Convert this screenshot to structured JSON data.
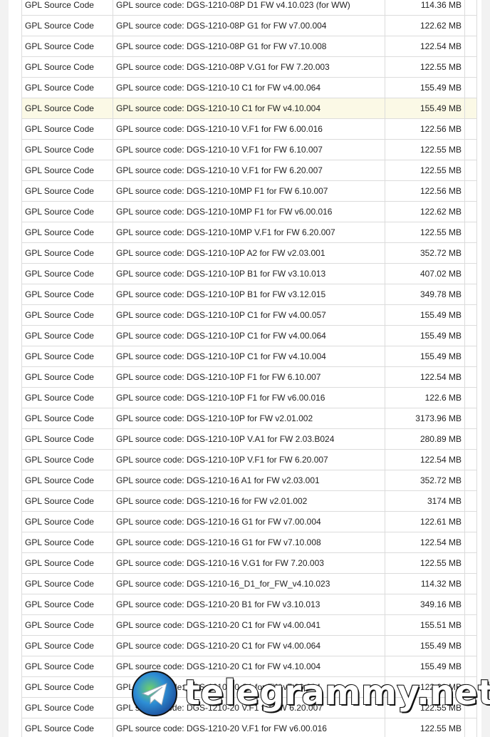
{
  "rows": [
    {
      "type": "GPL Source Code",
      "desc": "GPL source code: DGS-1210-08P D1 FW v4.10.023 (for WW)",
      "size": "114.36 MB"
    },
    {
      "type": "GPL Source Code",
      "desc": "GPL source code: DGS-1210-08P G1 for FW v7.00.004",
      "size": "122.62 MB"
    },
    {
      "type": "GPL Source Code",
      "desc": "GPL source code: DGS-1210-08P G1 for FW v7.10.008",
      "size": "122.54 MB"
    },
    {
      "type": "GPL Source Code",
      "desc": "GPL source code: DGS-1210-08P V.G1 for FW 7.20.003",
      "size": "122.55 MB"
    },
    {
      "type": "GPL Source Code",
      "desc": "GPL source code: DGS-1210-10 C1 for FW v4.00.064",
      "size": "155.49 MB"
    },
    {
      "type": "GPL Source Code",
      "desc": "GPL source code: DGS-1210-10 C1 for FW v4.10.004",
      "size": "155.49 MB",
      "highlight": true
    },
    {
      "type": "GPL Source Code",
      "desc": "GPL source code: DGS-1210-10 V.F1 for FW 6.00.016",
      "size": "122.56 MB"
    },
    {
      "type": "GPL Source Code",
      "desc": "GPL source code: DGS-1210-10 V.F1 for FW 6.10.007",
      "size": "122.55 MB"
    },
    {
      "type": "GPL Source Code",
      "desc": "GPL source code: DGS-1210-10 V.F1 for FW 6.20.007",
      "size": "122.55 MB"
    },
    {
      "type": "GPL Source Code",
      "desc": "GPL source code: DGS-1210-10MP F1 for FW 6.10.007",
      "size": "122.56 MB"
    },
    {
      "type": "GPL Source Code",
      "desc": "GPL source code: DGS-1210-10MP F1 for FW v6.00.016",
      "size": "122.62 MB"
    },
    {
      "type": "GPL Source Code",
      "desc": "GPL source code: DGS-1210-10MP V.F1 for FW 6.20.007",
      "size": "122.55 MB"
    },
    {
      "type": "GPL Source Code",
      "desc": "GPL source code: DGS-1210-10P A2 for FW v2.03.001",
      "size": "352.72 MB"
    },
    {
      "type": "GPL Source Code",
      "desc": "GPL source code: DGS-1210-10P B1 for FW v3.10.013",
      "size": "407.02 MB"
    },
    {
      "type": "GPL Source Code",
      "desc": "GPL source code: DGS-1210-10P B1 for FW v3.12.015",
      "size": "349.78 MB"
    },
    {
      "type": "GPL Source Code",
      "desc": "GPL source code: DGS-1210-10P C1 for FW v4.00.057",
      "size": "155.49 MB"
    },
    {
      "type": "GPL Source Code",
      "desc": "GPL source code: DGS-1210-10P C1 for FW v4.00.064",
      "size": "155.49 MB"
    },
    {
      "type": "GPL Source Code",
      "desc": "GPL source code: DGS-1210-10P C1 for FW v4.10.004",
      "size": "155.49 MB"
    },
    {
      "type": "GPL Source Code",
      "desc": "GPL source code: DGS-1210-10P F1 for FW 6.10.007",
      "size": "122.54 MB"
    },
    {
      "type": "GPL Source Code",
      "desc": "GPL source code: DGS-1210-10P F1 for FW v6.00.016",
      "size": "122.6 MB"
    },
    {
      "type": "GPL Source Code",
      "desc": "GPL source code: DGS-1210-10P for FW v2.01.002",
      "size": "3173.96 MB"
    },
    {
      "type": "GPL Source Code",
      "desc": "GPL source code: DGS-1210-10P V.A1 for FW 2.03.B024",
      "size": "280.89 MB"
    },
    {
      "type": "GPL Source Code",
      "desc": "GPL source code: DGS-1210-10P V.F1 for FW 6.20.007",
      "size": "122.54 MB"
    },
    {
      "type": "GPL Source Code",
      "desc": "GPL source code: DGS-1210-16 A1 for FW v2.03.001",
      "size": "352.72 MB"
    },
    {
      "type": "GPL Source Code",
      "desc": "GPL source code: DGS-1210-16 for FW v2.01.002",
      "size": "3174 MB"
    },
    {
      "type": "GPL Source Code",
      "desc": "GPL source code: DGS-1210-16 G1 for FW v7.00.004",
      "size": "122.61 MB"
    },
    {
      "type": "GPL Source Code",
      "desc": "GPL source code: DGS-1210-16 G1 for FW v7.10.008",
      "size": "122.54 MB"
    },
    {
      "type": "GPL Source Code",
      "desc": "GPL source code: DGS-1210-16 V.G1 for FW 7.20.003",
      "size": "122.55 MB"
    },
    {
      "type": "GPL Source Code",
      "desc": "GPL source code: DGS-1210-16_D1_for_FW_v4.10.023",
      "size": "114.32 MB"
    },
    {
      "type": "GPL Source Code",
      "desc": "GPL source code: DGS-1210-20 B1 for FW v3.10.013",
      "size": "349.16 MB"
    },
    {
      "type": "GPL Source Code",
      "desc": "GPL source code: DGS-1210-20 C1 for FW v4.00.041",
      "size": "155.51 MB"
    },
    {
      "type": "GPL Source Code",
      "desc": "GPL source code: DGS-1210-20 C1 for FW v4.00.064",
      "size": "155.49 MB"
    },
    {
      "type": "GPL Source Code",
      "desc": "GPL source code: DGS-1210-20 C1 for FW v4.10.004",
      "size": "155.49 MB"
    },
    {
      "type": "GPL Source Code",
      "desc": "GPL source code: DGS-1210-20 C1 for FW v7.00.004",
      "size": "122.61 MB"
    },
    {
      "type": "GPL Source Code",
      "desc": "GPL source code: DGS-1210-20 V.F1 for FW 6.20.007",
      "size": "122.55 MB"
    },
    {
      "type": "GPL Source Code",
      "desc": "GPL source code: DGS-1210-20 V.F1 for FW v6.00.016",
      "size": "122.55 MB"
    }
  ],
  "watermark": {
    "text": "telegrammy.net",
    "logo_icon": "telegram-logo-icon"
  },
  "colors": {
    "highlight_row": "#fbf9e6",
    "border": "#dcdcdc",
    "text": "#222222"
  }
}
